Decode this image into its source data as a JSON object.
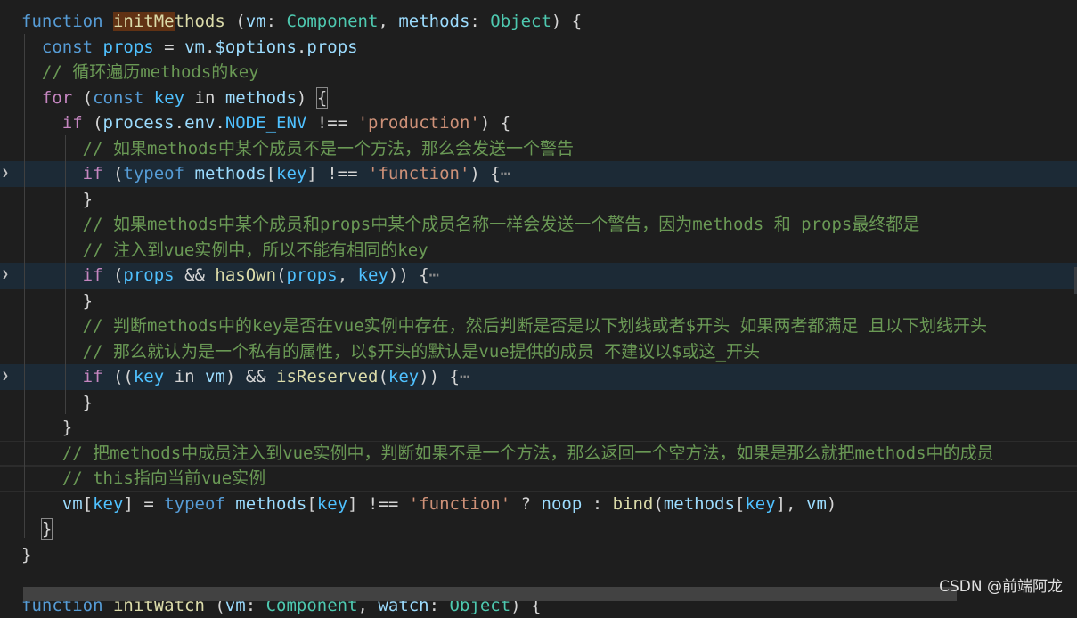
{
  "editor": {
    "lines": [
      {
        "indent": 0,
        "tokens": [
          [
            "kw",
            "function "
          ],
          [
            "fn-hl",
            "initMe"
          ],
          [
            "fn",
            "thods"
          ],
          [
            "pl",
            " ("
          ],
          [
            "var",
            "vm"
          ],
          [
            "pl",
            ": "
          ],
          [
            "type",
            "Component"
          ],
          [
            "pl",
            ", "
          ],
          [
            "var",
            "methods"
          ],
          [
            "pl",
            ": "
          ],
          [
            "type",
            "Object"
          ],
          [
            "pl",
            ") {"
          ]
        ]
      },
      {
        "indent": 2,
        "tokens": [
          [
            "kw",
            "const "
          ],
          [
            "cst",
            "props"
          ],
          [
            "pl",
            " = "
          ],
          [
            "var",
            "vm"
          ],
          [
            "pl",
            "."
          ],
          [
            "var",
            "$options"
          ],
          [
            "pl",
            "."
          ],
          [
            "var",
            "props"
          ]
        ]
      },
      {
        "indent": 2,
        "tokens": [
          [
            "cm",
            "// 循环遍历methods的key"
          ]
        ]
      },
      {
        "indent": 2,
        "tokens": [
          [
            "ctl",
            "for"
          ],
          [
            "pl",
            " ("
          ],
          [
            "kw",
            "const "
          ],
          [
            "cst",
            "key"
          ],
          [
            "pl",
            " in "
          ],
          [
            "var",
            "methods"
          ],
          [
            "pl",
            ") "
          ],
          [
            "br",
            "{"
          ]
        ]
      },
      {
        "indent": 4,
        "tokens": [
          [
            "ctl",
            "if"
          ],
          [
            "pl",
            " ("
          ],
          [
            "var",
            "process"
          ],
          [
            "pl",
            "."
          ],
          [
            "var",
            "env"
          ],
          [
            "pl",
            "."
          ],
          [
            "cst",
            "NODE_ENV"
          ],
          [
            "pl",
            " !== "
          ],
          [
            "str",
            "'production'"
          ],
          [
            "pl",
            ") {"
          ]
        ]
      },
      {
        "indent": 6,
        "tokens": [
          [
            "cm",
            "// 如果methods中某个成员不是一个方法，那么会发送一个警告"
          ]
        ]
      },
      {
        "indent": 6,
        "folded": true,
        "tokens": [
          [
            "ctl",
            "if"
          ],
          [
            "pl",
            " ("
          ],
          [
            "kw",
            "typeof "
          ],
          [
            "var",
            "methods"
          ],
          [
            "pl",
            "["
          ],
          [
            "cst",
            "key"
          ],
          [
            "pl",
            "] !== "
          ],
          [
            "str",
            "'function'"
          ],
          [
            "pl",
            ") {"
          ],
          [
            "ellipsis",
            "⋯"
          ]
        ]
      },
      {
        "indent": 6,
        "tokens": [
          [
            "pl",
            "}"
          ]
        ]
      },
      {
        "indent": 6,
        "tokens": [
          [
            "cm",
            "// 如果methods中某个成员和props中某个成员名称一样会发送一个警告，因为methods 和 props最终都是"
          ]
        ]
      },
      {
        "indent": 6,
        "tokens": [
          [
            "cm",
            "// 注入到vue实例中，所以不能有相同的key"
          ]
        ]
      },
      {
        "indent": 6,
        "folded": true,
        "tokens": [
          [
            "ctl",
            "if"
          ],
          [
            "pl",
            " ("
          ],
          [
            "cst",
            "props"
          ],
          [
            "pl",
            " && "
          ],
          [
            "fn",
            "hasOwn"
          ],
          [
            "pl",
            "("
          ],
          [
            "cst",
            "props"
          ],
          [
            "pl",
            ", "
          ],
          [
            "cst",
            "key"
          ],
          [
            "pl",
            ")) {"
          ],
          [
            "ellipsis",
            "⋯"
          ]
        ]
      },
      {
        "indent": 6,
        "tokens": [
          [
            "pl",
            "}"
          ]
        ]
      },
      {
        "indent": 6,
        "tokens": [
          [
            "cm",
            "// 判断methods中的key是否在vue实例中存在，然后判断是否是以下划线或者$开头 如果两者都满足 且以下划线开头"
          ]
        ]
      },
      {
        "indent": 6,
        "tokens": [
          [
            "cm",
            "// 那么就认为是一个私有的属性，以$开头的默认是vue提供的成员 不建议以$或这_开头"
          ]
        ]
      },
      {
        "indent": 6,
        "folded": true,
        "tokens": [
          [
            "ctl",
            "if"
          ],
          [
            "pl",
            " (("
          ],
          [
            "cst",
            "key"
          ],
          [
            "pl",
            " in "
          ],
          [
            "var",
            "vm"
          ],
          [
            "pl",
            ") && "
          ],
          [
            "fn",
            "isReserved"
          ],
          [
            "pl",
            "("
          ],
          [
            "cst",
            "key"
          ],
          [
            "pl",
            ")) {"
          ],
          [
            "ellipsis",
            "⋯"
          ]
        ]
      },
      {
        "indent": 6,
        "tokens": [
          [
            "pl",
            "}"
          ]
        ]
      },
      {
        "indent": 4,
        "tokens": [
          [
            "pl",
            "}"
          ]
        ]
      },
      {
        "indent": 4,
        "current": true,
        "tokens": [
          [
            "cm",
            "// 把methods中成员注入到vue实例中，判断如果不是一个方法，那么返回一个空方法，如果是那么就把methods中的成员"
          ]
        ]
      },
      {
        "indent": 4,
        "current": true,
        "tokens": [
          [
            "cm",
            "// this指向当前vue实例"
          ]
        ]
      },
      {
        "indent": 4,
        "tokens": [
          [
            "var",
            "vm"
          ],
          [
            "pl",
            "["
          ],
          [
            "cst",
            "key"
          ],
          [
            "pl",
            "] = "
          ],
          [
            "kw",
            "typeof "
          ],
          [
            "var",
            "methods"
          ],
          [
            "pl",
            "["
          ],
          [
            "cst",
            "key"
          ],
          [
            "pl",
            "] !== "
          ],
          [
            "str",
            "'function'"
          ],
          [
            "pl",
            " ? "
          ],
          [
            "var",
            "noop"
          ],
          [
            "pl",
            " : "
          ],
          [
            "fn",
            "bind"
          ],
          [
            "pl",
            "("
          ],
          [
            "var",
            "methods"
          ],
          [
            "pl",
            "["
          ],
          [
            "cst",
            "key"
          ],
          [
            "pl",
            "], "
          ],
          [
            "var",
            "vm"
          ],
          [
            "pl",
            ")"
          ]
        ]
      },
      {
        "indent": 2,
        "tokens": [
          [
            "br",
            "}"
          ]
        ]
      },
      {
        "indent": 0,
        "tokens": [
          [
            "pl",
            "}"
          ]
        ]
      },
      {
        "indent": 0,
        "tokens": []
      },
      {
        "indent": 0,
        "tokens": [
          [
            "kw",
            "function "
          ],
          [
            "fn",
            "initWatch"
          ],
          [
            "pl",
            " ("
          ],
          [
            "var",
            "vm"
          ],
          [
            "pl",
            ": "
          ],
          [
            "type",
            "Component"
          ],
          [
            "pl",
            ", "
          ],
          [
            "var",
            "watch"
          ],
          [
            "pl",
            ": "
          ],
          [
            "type",
            "Object"
          ],
          [
            "pl",
            ") {"
          ]
        ]
      }
    ],
    "fold_icon": "chevron-right-icon"
  },
  "watermark": "CSDN @前端阿龙",
  "colors": {
    "background": "#1e1e1e",
    "keyword": "#569cd6",
    "control": "#c586c0",
    "function": "#dcdcaa",
    "variable": "#9cdcfe",
    "constant": "#4fc1ff",
    "type": "#4ec9b0",
    "string": "#ce9178",
    "comment": "#6a9955"
  }
}
